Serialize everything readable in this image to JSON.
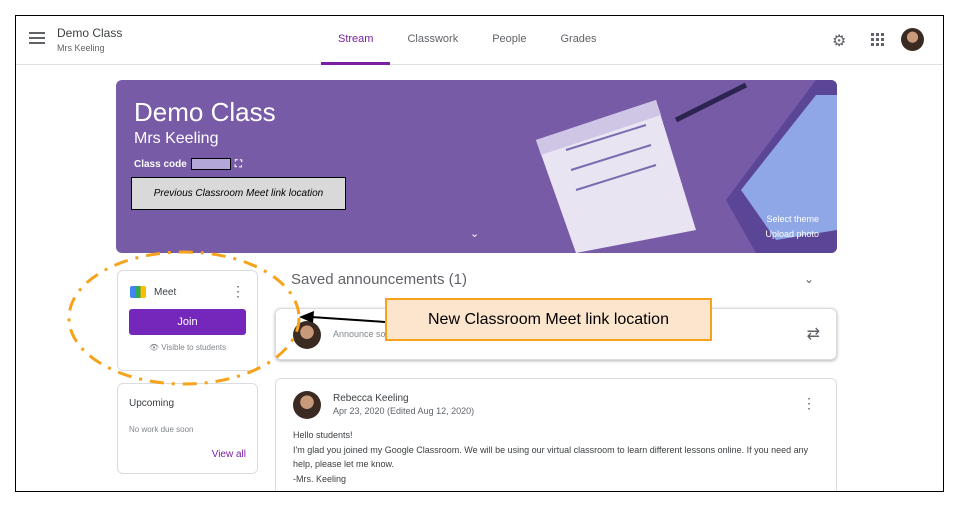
{
  "header": {
    "class_title": "Demo Class",
    "teacher": "Mrs Keeling",
    "tabs": [
      {
        "label": "Stream",
        "active": true
      },
      {
        "label": "Classwork"
      },
      {
        "label": "People"
      },
      {
        "label": "Grades"
      }
    ]
  },
  "banner": {
    "title": "Demo Class",
    "subtitle": "Mrs Keeling",
    "class_code_label": "Class code",
    "select_theme": "Select theme",
    "upload_photo": "Upload photo",
    "annotation": "Previous Classroom Meet link location",
    "color": "#775ba6"
  },
  "meet": {
    "label": "Meet",
    "join": "Join",
    "visibility": "Visible to students"
  },
  "upcoming": {
    "title": "Upcoming",
    "empty": "No work due soon",
    "view_all": "View all"
  },
  "stream": {
    "saved": "Saved announcements (1)",
    "announce_placeholder": "Announce so",
    "post": {
      "author": "Rebecca Keeling",
      "date": "Apr 23, 2020 (Edited Aug 12, 2020)",
      "lines": [
        "Hello students!",
        "I'm glad you joined my Google Classroom. We will be using our virtual classroom to learn different lessons online. If you need any help, please let me know.",
        "-Mrs. Keeling"
      ]
    }
  },
  "callout": {
    "text": "New Classroom Meet link location",
    "color": "#f6a31b"
  },
  "accent": "#7b1fa2"
}
